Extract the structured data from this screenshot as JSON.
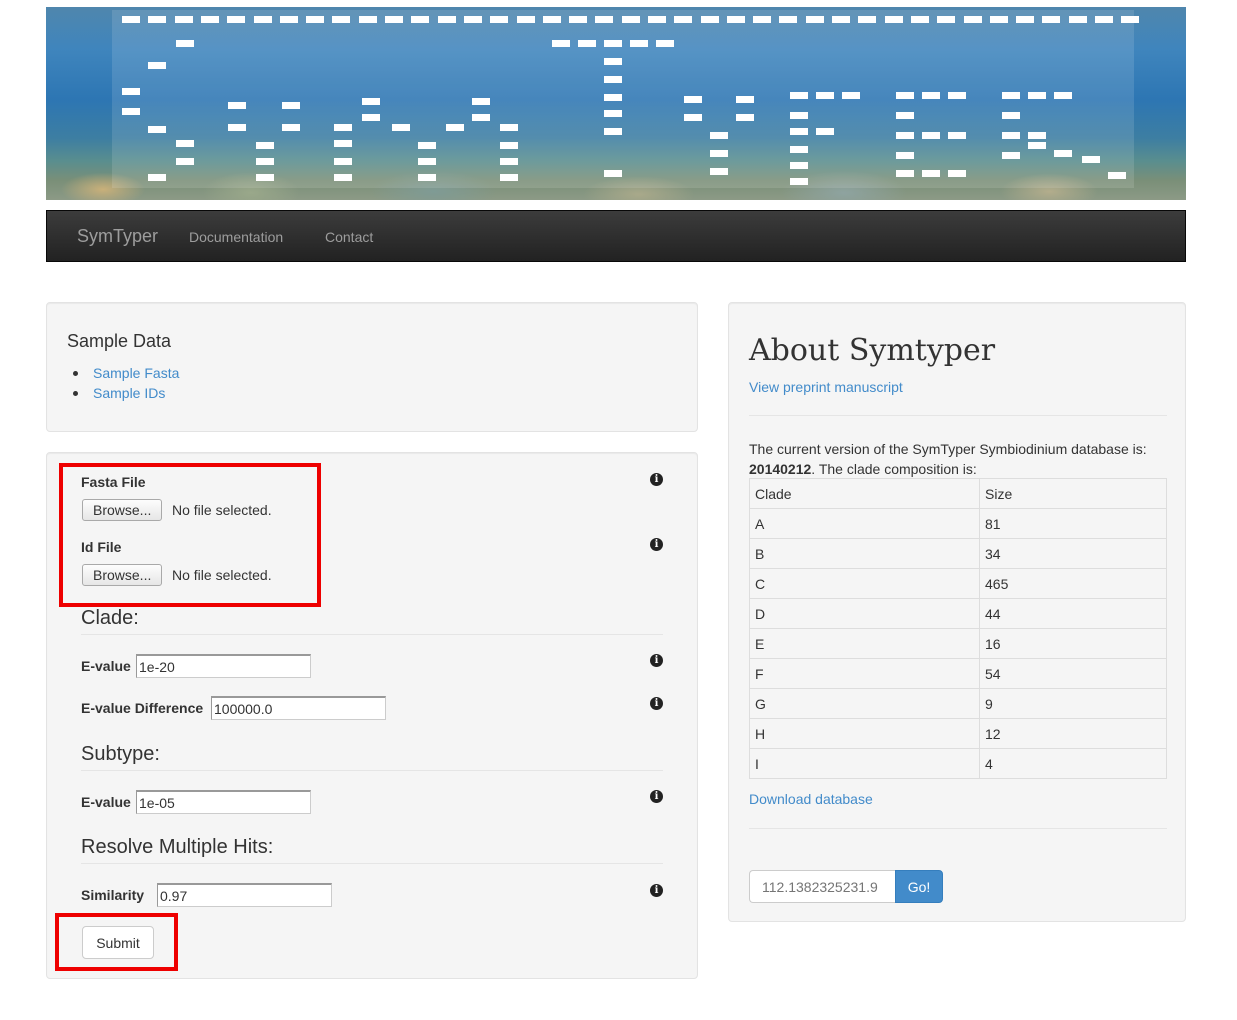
{
  "banner": {
    "alt": "SymTyper banner over coral reef"
  },
  "nav": {
    "brand": "SymTyper",
    "links": [
      "Documentation",
      "Contact"
    ]
  },
  "sample_data": {
    "title": "Sample Data",
    "links": [
      "Sample Fasta",
      "Sample IDs"
    ]
  },
  "form": {
    "fasta_label": "Fasta File",
    "id_label": "Id File",
    "browse_label": "Browse...",
    "no_file_text": "No file selected.",
    "clade_heading": "Clade:",
    "clade_evalue_label": "E-value",
    "clade_evalue_value": "1e-20",
    "evalue_diff_label": "E-value Difference",
    "evalue_diff_value": "100000.0",
    "subtype_heading": "Subtype:",
    "subtype_evalue_label": "E-value",
    "subtype_evalue_value": "1e-05",
    "resolve_heading": "Resolve Multiple Hits:",
    "similarity_label": "Similarity",
    "similarity_value": "0.97",
    "submit_label": "Submit",
    "info_glyph": "i"
  },
  "about": {
    "title": "About Symtyper",
    "preprint_link": "View preprint manuscript",
    "text_before": "The current version of the SymTyper Symbiodinium database is: ",
    "db_version": "20140212",
    "text_after": ". The clade composition is:",
    "table_headers": [
      "Clade",
      "Size"
    ],
    "table_rows": [
      [
        "A",
        "81"
      ],
      [
        "B",
        "34"
      ],
      [
        "C",
        "465"
      ],
      [
        "D",
        "44"
      ],
      [
        "E",
        "16"
      ],
      [
        "F",
        "54"
      ],
      [
        "G",
        "9"
      ],
      [
        "H",
        "12"
      ],
      [
        "I",
        "4"
      ]
    ],
    "download_link": "Download database",
    "id_placeholder": "112.1382325231.9",
    "go_label": "Go!"
  },
  "colors": {
    "link": "#428bca",
    "highlight": "#ee0000",
    "go_button": "#428bca",
    "navbar": "#222222"
  }
}
